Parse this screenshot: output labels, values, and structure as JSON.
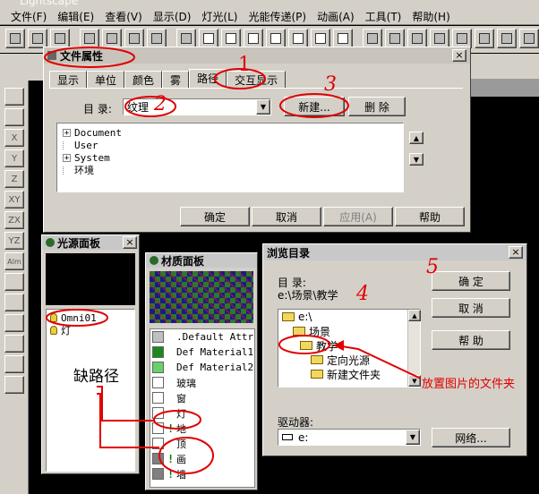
{
  "menubar": {
    "app_title": "Lightscape",
    "items": [
      "文件(F)",
      "编辑(E)",
      "查看(V)",
      "显示(D)",
      "灯光(L)",
      "光能传递(P)",
      "动画(A)",
      "工具(T)",
      "帮助(H)"
    ]
  },
  "file_props": {
    "title": "文件属性",
    "tabs": [
      "显示",
      "单位",
      "颜色",
      "雾",
      "路径",
      "交互显示"
    ],
    "dir_label": "目 录:",
    "dir_value": "纹理",
    "new_btn": "新建...",
    "delete_btn": "删 除",
    "tree": [
      "Document",
      "User",
      "System",
      "环境"
    ],
    "ok": "确定",
    "cancel": "取消",
    "apply": "应用(A)",
    "help": "帮助"
  },
  "light_panel": {
    "title": "光源面板",
    "items": [
      "Omni01",
      "灯"
    ]
  },
  "material_panel": {
    "title": "材质面板",
    "items": [
      ".Default Attr",
      "Def Material1",
      "Def Material2",
      "玻璃",
      "窗",
      "灯",
      "地",
      "顶",
      "画",
      "墙"
    ],
    "swatch_colors": [
      "#c0c0c0",
      "#1a8a1a",
      "#6ad06a",
      "#ffffff",
      "#ffffff",
      "#ffffff",
      "#ffffff",
      "#ffffff",
      "#808080",
      "#808080"
    ]
  },
  "browse": {
    "title": "浏览目录",
    "dir_label": "目 录:",
    "dir_path": "e:\\场景\\教学",
    "ok": "确  定",
    "cancel": "取  消",
    "help": "帮  助",
    "folders": [
      "e:\\",
      "场景",
      "教学",
      "定向光源",
      "新建文件夹"
    ],
    "drive_label": "驱动器:",
    "drive_value": "e:",
    "network": "网络..."
  },
  "annotations": {
    "n1": "1",
    "n2": "2",
    "n3": "3",
    "n4": "4",
    "n5": "5",
    "missing_path": "缺路径",
    "folder_note": "放置图片的文件夹"
  },
  "side_toolbar": [
    "X",
    "Y",
    "Z",
    "XY",
    "ZX",
    "YZ",
    "Alm"
  ],
  "colors": {
    "annotation_red": "#e00000",
    "window_gray": "#d4d0c8"
  }
}
